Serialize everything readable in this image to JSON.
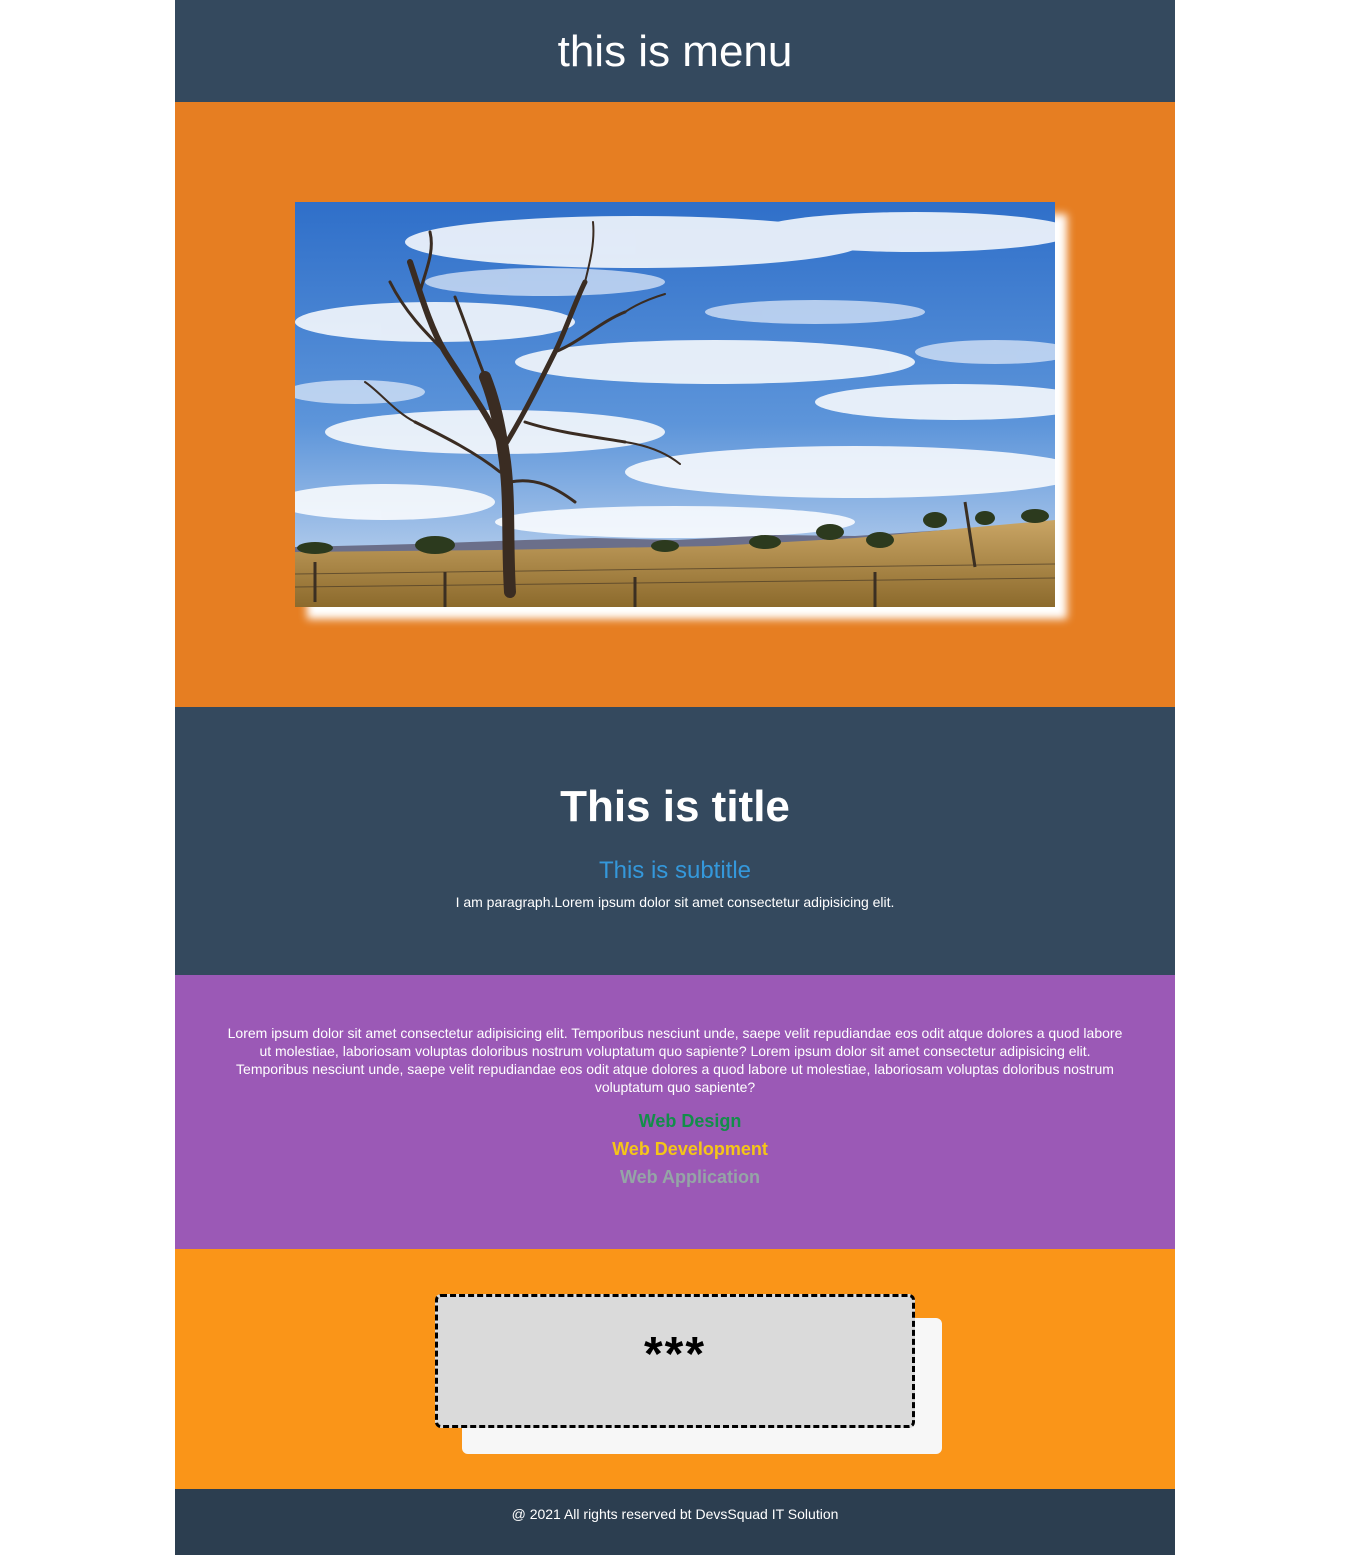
{
  "menu": {
    "title": "this is menu"
  },
  "hero": {
    "image_alt": "Dead tree in a dry field under a blue cloudy sky"
  },
  "intro": {
    "title": "This is title",
    "subtitle": "This is subtitle",
    "paragraph": "I am paragraph.Lorem ipsum dolor sit amet consectetur adipisicing elit."
  },
  "about": {
    "text": "Lorem ipsum dolor sit amet consectetur adipisicing elit. Temporibus nesciunt unde, saepe velit repudiandae eos odit atque dolores a quod labore ut molestiae, laboriosam voluptas doloribus nostrum voluptatum quo sapiente? Lorem ipsum dolor sit amet consectetur adipisicing elit. Temporibus nesciunt unde, saepe velit repudiandae eos odit atque dolores a quod labore ut molestiae, laboriosam voluptas doloribus nostrum voluptatum quo sapiente?",
    "services": [
      "Web Design",
      "Web Development",
      "Web Application"
    ]
  },
  "card": {
    "text": "***"
  },
  "footer": {
    "text": "@ 2021 All rights reserved bt DevsSquad IT Solution"
  },
  "colors": {
    "menu_bg": "#34495e",
    "hero_bg": "#e67e22",
    "purple_bg": "#9b59b6",
    "orange_bg": "#fa9518",
    "footer_bg": "#2c3e50",
    "subtitle": "#3498db"
  }
}
